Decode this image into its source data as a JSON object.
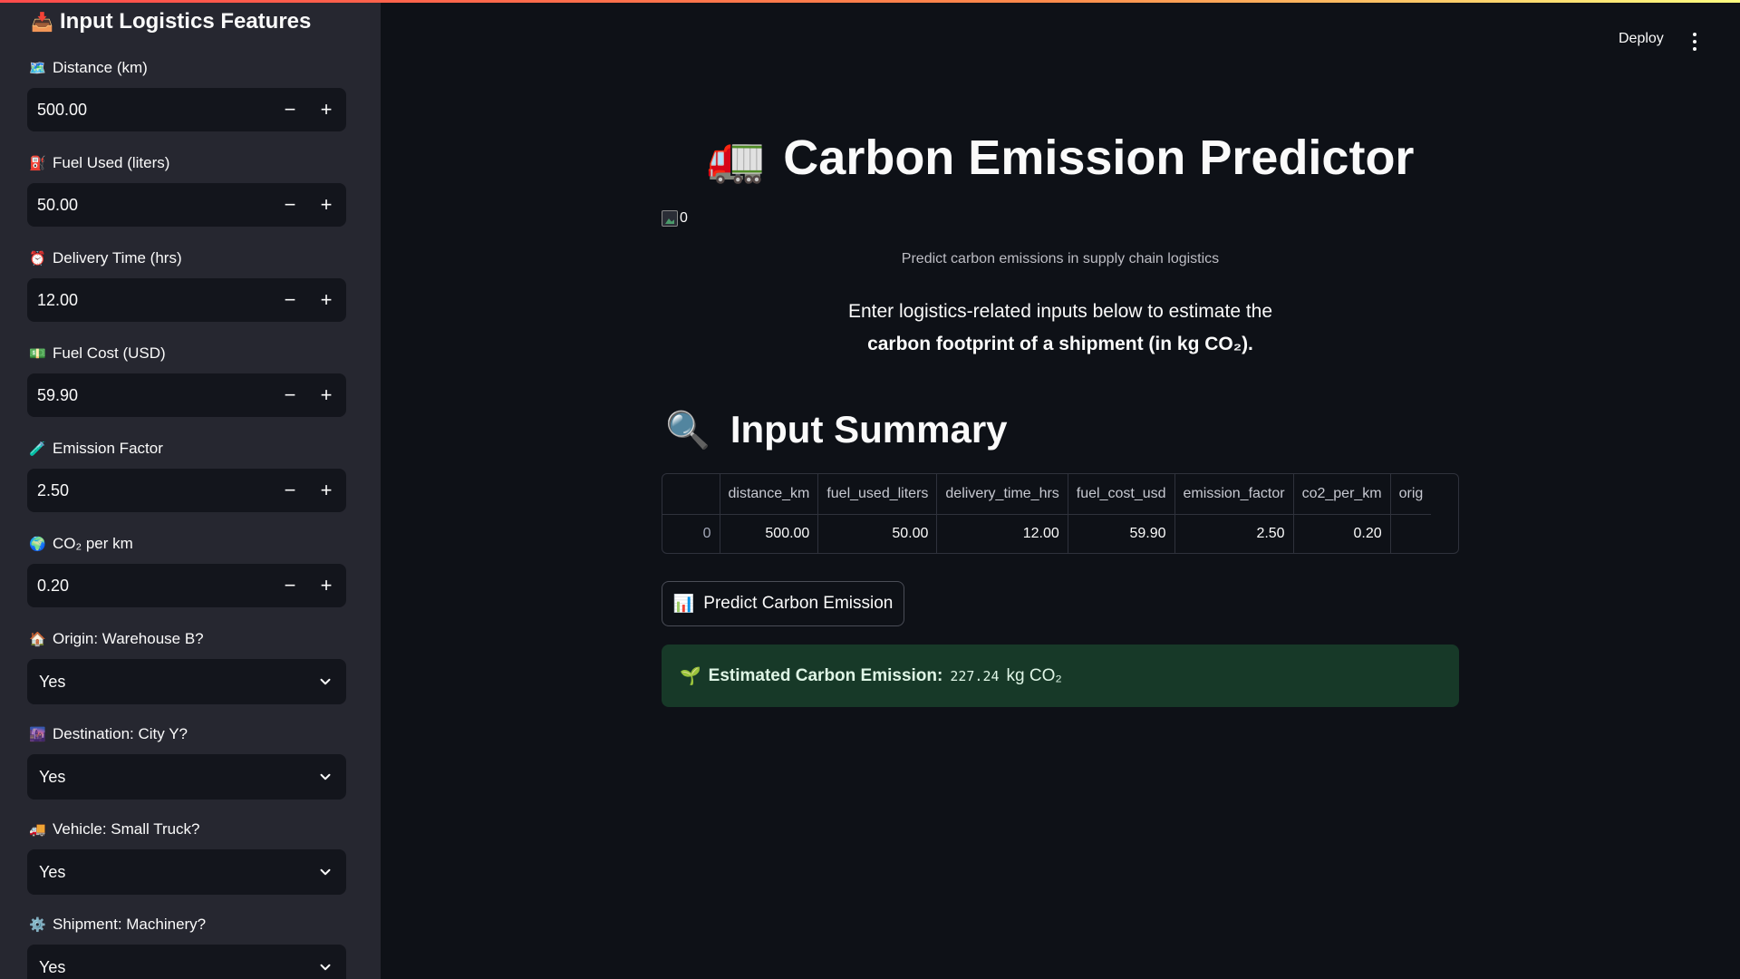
{
  "sidebar": {
    "title": "Input Logistics Features",
    "title_icon": "inbox-tray-icon",
    "numeric_fields": [
      {
        "label": "Distance (km)",
        "icon": "map-icon",
        "value": "500.00"
      },
      {
        "label": "Fuel Used (liters)",
        "icon": "fuel-pump-icon",
        "value": "50.00"
      },
      {
        "label": "Delivery Time (hrs)",
        "icon": "alarm-clock-icon",
        "value": "12.00"
      },
      {
        "label": "Fuel Cost (USD)",
        "icon": "dollar-banknote-icon",
        "value": "59.90"
      },
      {
        "label": "Emission Factor",
        "icon": "test-tube-icon",
        "value": "2.50"
      },
      {
        "label": "CO₂ per km",
        "icon": "globe-icon",
        "value": "0.20"
      }
    ],
    "select_fields": [
      {
        "label": "Origin: Warehouse B?",
        "icon": "house-icon",
        "value": "Yes"
      },
      {
        "label": "Destination: City Y?",
        "icon": "cityscape-icon",
        "value": "Yes"
      },
      {
        "label": "Vehicle: Small Truck?",
        "icon": "delivery-truck-icon",
        "value": "Yes"
      },
      {
        "label": "Shipment: Machinery?",
        "icon": "gear-icon",
        "value": "Yes"
      }
    ],
    "minus_glyph": "−",
    "plus_glyph": "+"
  },
  "header": {
    "deploy_label": "Deploy"
  },
  "main": {
    "title": "Carbon Emission Predictor",
    "title_icon": "articulated-lorry-icon",
    "broken_image_alt": "0",
    "subtitle": "Predict carbon emissions in supply chain logistics",
    "description_line1": "Enter logistics-related inputs below to estimate the",
    "description_line2": "carbon footprint of a shipment (in kg CO₂).",
    "summary_title": "Input Summary",
    "summary_icon": "magnifying-glass-icon",
    "table": {
      "columns": [
        "",
        "distance_km",
        "fuel_used_liters",
        "delivery_time_hrs",
        "fuel_cost_usd",
        "emission_factor",
        "co2_per_km",
        "orig"
      ],
      "rows": [
        [
          "0",
          "500.00",
          "50.00",
          "12.00",
          "59.90",
          "2.50",
          "0.20",
          ""
        ]
      ]
    },
    "predict_button": "Predict Carbon Emission",
    "predict_icon": "bar-chart-icon",
    "result_label": "Estimated Carbon Emission:",
    "result_value": "227.24",
    "result_unit": "kg CO₂",
    "result_icon": "seedling-icon"
  }
}
